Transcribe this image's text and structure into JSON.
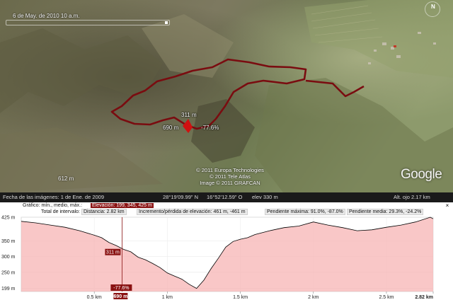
{
  "map": {
    "timestamp": "6 de May. de 2010  10 a.m.",
    "elevation_marker": "612 m",
    "copyright_lines": [
      "© 2011 Europa Technologies",
      "© 2011 Tele Atlas",
      "Image © 2011 GRAFCAN"
    ],
    "logo": "Google",
    "compass_label": "N",
    "tags": {
      "peak": "311 m",
      "left": "690 m",
      "slope": "-77.6%"
    },
    "colors": {
      "route": "#7a0c10",
      "marker": "#d01010"
    }
  },
  "status_bar": {
    "imagery_date": "Fecha de las imágenes:  1 de Ene. de 2009",
    "lat": "28°19'09.99\" N",
    "lon": "16°52'12.59\" O",
    "elev": "elev   330 m",
    "eye_alt": "Alt. ojo   2.17 km"
  },
  "elevation_panel": {
    "chart_label": "Gráfico: mín., medio, máx.:",
    "elevation_stats": "Elevación: 199, 345, 425 m",
    "total_label": "Total de intervalo:",
    "distance": "Distancia: 2.82 km",
    "gain_loss": "Incremento/pérdida de elevación: 461 m, -461 m",
    "max_slope": "Pendiente máxima: 91.0%, -87.0%",
    "avg_slope": "Pendiente media: 29.3%, -24.2%",
    "close_icon": "×",
    "cursor": {
      "elevation": "311 m",
      "slope": "-77.6%",
      "distance": "690 m"
    }
  },
  "chart_data": {
    "type": "area",
    "xlabel": "",
    "ylabel": "",
    "x_unit": "km",
    "y_unit": "m",
    "xlim": [
      0,
      2.82
    ],
    "ylim": [
      189,
      425
    ],
    "y_ticks": [
      "425 m",
      "350 m",
      "300 m",
      "250 m",
      "199 m"
    ],
    "y_tick_values": [
      425,
      350,
      300,
      250,
      199
    ],
    "x_ticks": [
      "0.5 km",
      "1 km",
      "1.5 km",
      "2 km",
      "2.5 km",
      "2.82 km"
    ],
    "x_tick_values": [
      0.5,
      1,
      1.5,
      2,
      2.5,
      2.82
    ],
    "fill_color": "#f7b4b4",
    "line_color": "#000000",
    "series": [
      {
        "x": [
          0,
          0.1,
          0.2,
          0.3,
          0.4,
          0.5,
          0.55,
          0.6,
          0.65,
          0.7,
          0.75,
          0.8,
          0.85,
          0.9,
          0.95,
          1.0,
          1.05,
          1.1,
          1.15,
          1.2,
          1.25,
          1.3,
          1.35,
          1.4,
          1.45,
          1.5,
          1.55,
          1.6,
          1.7,
          1.8,
          1.9,
          2.0,
          2.1,
          2.2,
          2.3,
          2.4,
          2.5,
          2.6,
          2.7,
          2.8,
          2.82
        ],
        "y": [
          412,
          407,
          400,
          393,
          382,
          368,
          360,
          345,
          335,
          323,
          315,
          298,
          290,
          278,
          265,
          248,
          238,
          228,
          212,
          199,
          225,
          262,
          295,
          330,
          348,
          355,
          360,
          370,
          382,
          392,
          397,
          410,
          400,
          392,
          382,
          385,
          393,
          400,
          410,
          425,
          420
        ]
      }
    ]
  }
}
